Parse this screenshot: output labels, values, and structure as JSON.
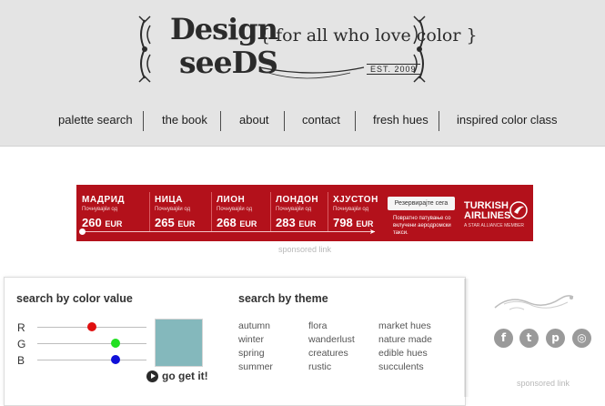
{
  "logo": {
    "line1": "Design",
    "line2": "seeDS",
    "tagline": "{ for all who love color }",
    "est": "EST. 2009"
  },
  "nav": [
    "palette search",
    "the book",
    "about",
    "contact",
    "fresh hues",
    "inspired color class"
  ],
  "ad": {
    "cities": [
      {
        "name": "МАДРИД",
        "sub": "Почнувајќи од",
        "price": "260",
        "currency": "EUR"
      },
      {
        "name": "НИЦА",
        "sub": "Почнувајќи од",
        "price": "265",
        "currency": "EUR"
      },
      {
        "name": "ЛИОН",
        "sub": "Почнувајќи од",
        "price": "268",
        "currency": "EUR"
      },
      {
        "name": "ЛОНДОН",
        "sub": "Почнувајќи од",
        "price": "283",
        "currency": "EUR"
      },
      {
        "name": "ХЈУСТОН",
        "sub": "Почнувајќи од",
        "price": "798",
        "currency": "EUR"
      }
    ],
    "button": "Резервирајте сега",
    "text": "Повратно патување со вклучени аеродромски такси.",
    "brand_line1": "TURKISH",
    "brand_line2": "AIRLINES",
    "brand_sub": "A STAR ALLIANCE MEMBER",
    "color": "#b3111b"
  },
  "sponsored_label": "sponsored link",
  "color_search": {
    "heading": "search by color value",
    "channels": [
      {
        "label": "R",
        "color": "#e01010",
        "value": 0.5
      },
      {
        "label": "G",
        "color": "#22e022",
        "value": 0.72
      },
      {
        "label": "B",
        "color": "#1010d8",
        "value": 0.72
      }
    ],
    "swatch_color": "#84b8bc",
    "go_label": "go get it!"
  },
  "theme_search": {
    "heading": "search by theme",
    "columns": [
      [
        "autumn",
        "winter",
        "spring",
        "summer"
      ],
      [
        "flora",
        "wanderlust",
        "creatures",
        "rustic"
      ],
      [
        "market hues",
        "nature made",
        "edible hues",
        "succulents"
      ]
    ]
  },
  "social": [
    {
      "icon": "facebook-icon",
      "glyph": "f"
    },
    {
      "icon": "twitter-icon",
      "glyph": "t"
    },
    {
      "icon": "pinterest-icon",
      "glyph": "p"
    },
    {
      "icon": "instagram-icon",
      "glyph": "◎"
    }
  ]
}
